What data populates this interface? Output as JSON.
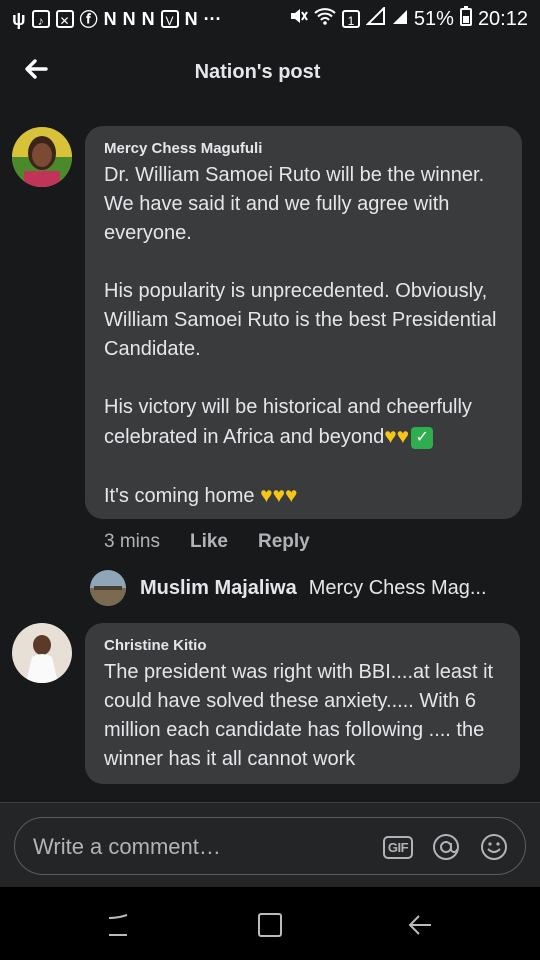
{
  "status_bar": {
    "notification_icons": [
      "usb-icon",
      "tiktok-icon",
      "photo-icon",
      "facebook-icon",
      "n-app-icon",
      "n-app-icon",
      "n-app-icon",
      "v-app-icon",
      "n-app-icon"
    ],
    "more": "···",
    "sim_badge": "1",
    "battery_percent": "51%",
    "time": "20:12"
  },
  "header": {
    "title": "Nation's post"
  },
  "comments": [
    {
      "author": "Mercy Chess Magufuli",
      "paragraphs": [
        [
          "Dr. William Samoei Ruto will be the winner. We have said it and we fully agree with everyone."
        ],
        [
          "His popularity is unprecedented. Obviously, William Samoei Ruto is the best Presidential Candidate."
        ],
        [
          "His victory will be historical and cheerfully celebrated in Africa and beyond"
        ],
        [
          "It's coming home "
        ]
      ],
      "time": "3 mins",
      "like_label": "Like",
      "reply_label": "Reply",
      "reply_preview": {
        "author": "Muslim Majaliwa",
        "text": "Mercy Chess Mag..."
      }
    },
    {
      "author": "Christine Kitio",
      "text": "The president was right with BBI....at least it could have solved these anxiety..... With 6 million each candidate has following .... the winner has it all cannot work"
    }
  ],
  "composer": {
    "placeholder": "Write a comment…",
    "gif_label": "GIF"
  },
  "colors": {
    "background": "#18191a",
    "bubble": "#3a3b3c",
    "text": "#e4e6eb",
    "secondary_text": "#b0b3b8",
    "heart": "#f5c518",
    "check": "#2eae4f"
  }
}
